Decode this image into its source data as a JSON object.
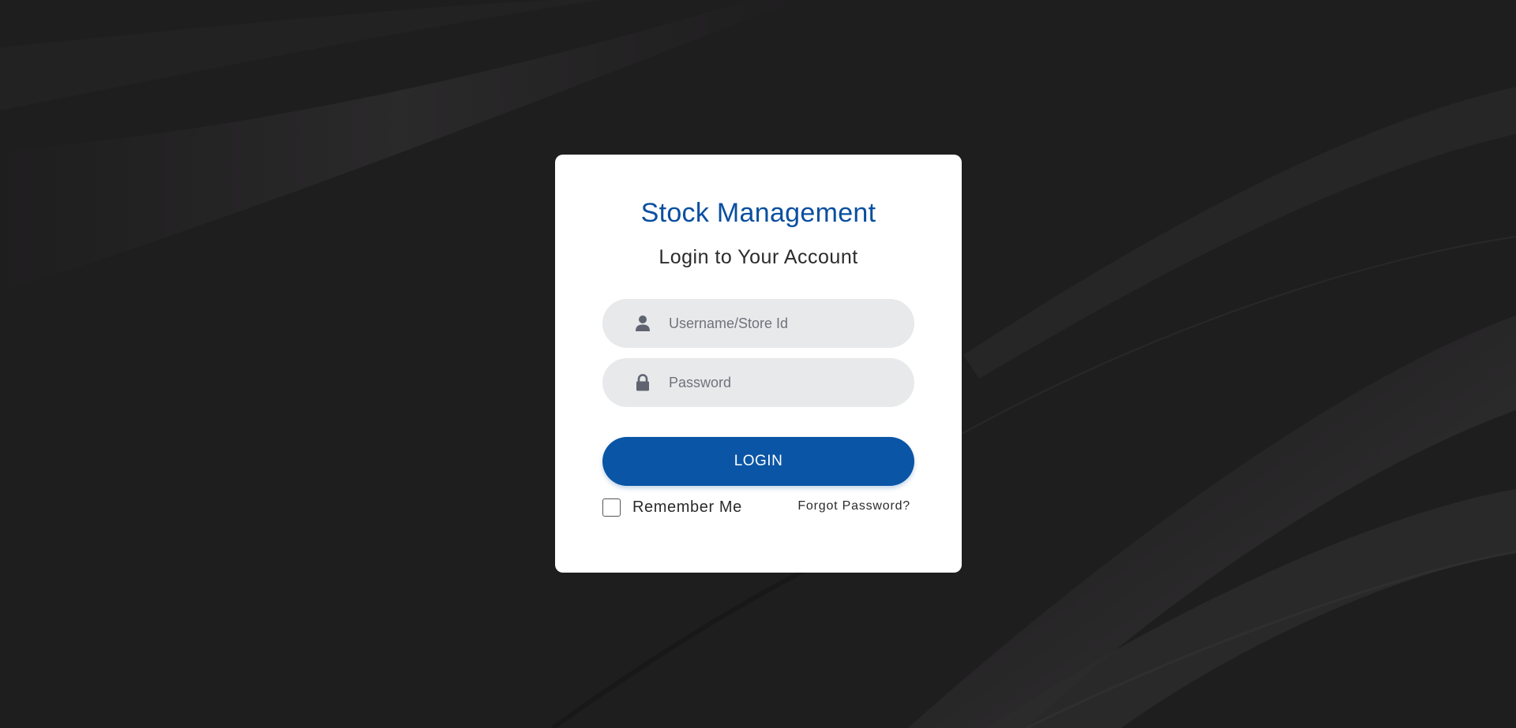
{
  "app": {
    "title": "Stock Management",
    "subtitle": "Login to Your Account"
  },
  "form": {
    "username": {
      "placeholder": "Username/Store Id",
      "value": "",
      "icon": "user-icon"
    },
    "password": {
      "placeholder": "Password",
      "value": "",
      "icon": "lock-icon"
    },
    "login_label": "LOGIN",
    "remember_label": "Remember Me",
    "remember_checked": false,
    "forgot_label": "Forgot Password?"
  },
  "colors": {
    "brand": "#0a55a5",
    "title": "#0a4fa0",
    "background": "#1f1e1f",
    "field": "#e8e9eb"
  }
}
